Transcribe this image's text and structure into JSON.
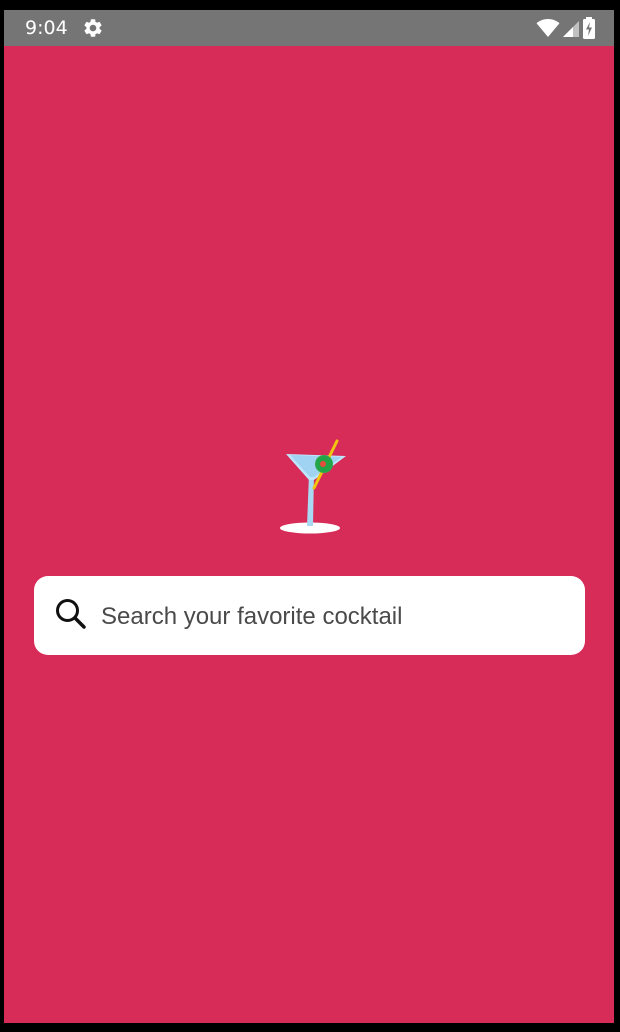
{
  "status_bar": {
    "time": "9:04",
    "icons": [
      "settings-gear-icon",
      "wifi-icon",
      "cellular-signal-icon",
      "battery-charging-icon"
    ],
    "background_color": "#757575"
  },
  "screen": {
    "background_color": "#d72b58"
  },
  "logo": {
    "icon": "martini-cocktail-icon"
  },
  "search": {
    "placeholder": "Search your favorite cocktail",
    "value": "",
    "icon": "search-icon"
  }
}
